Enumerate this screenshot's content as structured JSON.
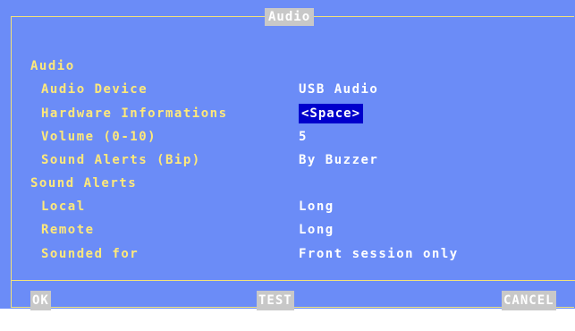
{
  "dialog": {
    "title": "Audio"
  },
  "sections": {
    "audio_header": "Audio",
    "sound_alerts_header": "Sound Alerts"
  },
  "fields": {
    "audio_device": {
      "label": "Audio Device",
      "value": "USB Audio"
    },
    "hardware_info": {
      "label": "Hardware Informations",
      "value": "<Space>"
    },
    "volume": {
      "label": "Volume (0-10)",
      "value": "5"
    },
    "sound_alerts_bip": {
      "label": "Sound Alerts (Bip)",
      "value": "By Buzzer"
    },
    "local": {
      "label": "Local",
      "value": "Long"
    },
    "remote": {
      "label": "Remote",
      "value": "Long"
    },
    "sounded_for": {
      "label": "Sounded for",
      "value": "Front session only"
    }
  },
  "buttons": {
    "ok": "OK",
    "test": "TEST",
    "cancel": "CANCEL"
  },
  "colors": {
    "background": "#6b8cf7",
    "label": "#ffe97a",
    "value": "#ffffff",
    "focus": "#0000cc",
    "button": "#c8c8c8",
    "border": "#f2e27a"
  }
}
